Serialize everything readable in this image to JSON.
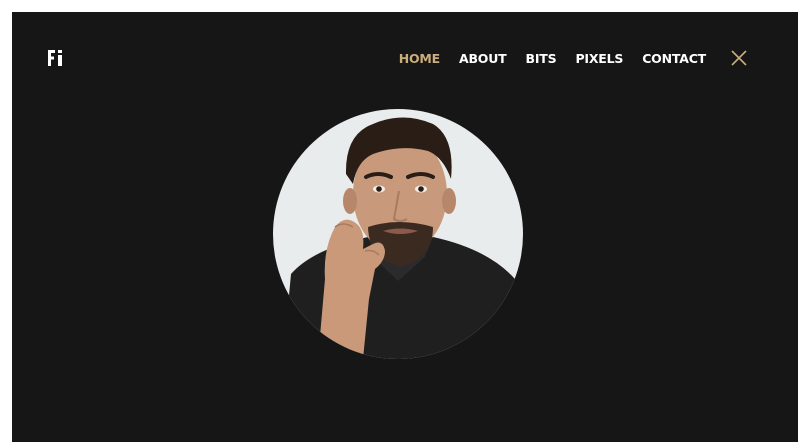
{
  "site": {
    "logo_text": "Fi",
    "brand_color": "#c9ad7c",
    "background": "#161616"
  },
  "nav": {
    "items": [
      {
        "label": "HOME",
        "active": true
      },
      {
        "label": "ABOUT",
        "active": false
      },
      {
        "label": "BITS",
        "active": false
      },
      {
        "label": "PIXELS",
        "active": false
      },
      {
        "label": "CONTACT",
        "active": false
      }
    ],
    "close_icon": "close-icon"
  },
  "hero": {
    "avatar_icon": "portrait-photo"
  }
}
